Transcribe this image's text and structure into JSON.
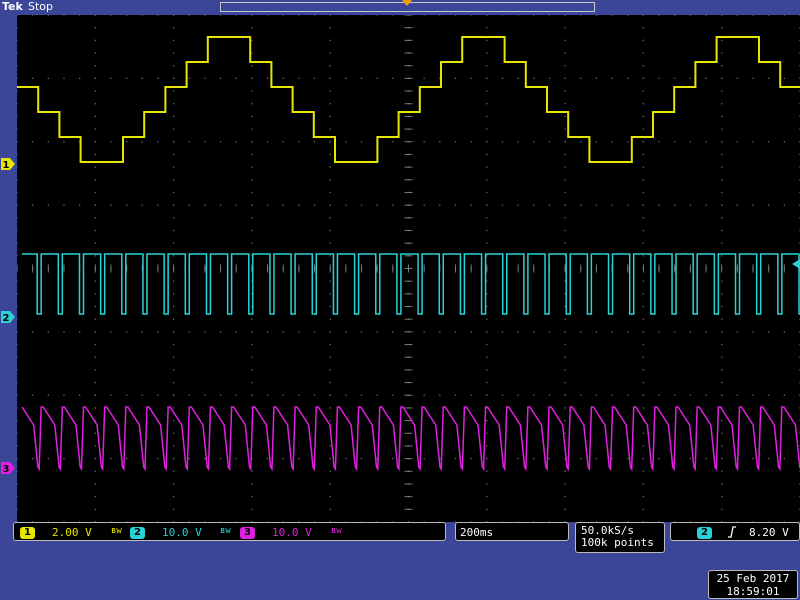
{
  "header": {
    "brand": "Tek",
    "state": "Stop"
  },
  "channels": [
    {
      "id": "1",
      "scale": "2.00 V",
      "color": "#e6e600",
      "marker": "1"
    },
    {
      "id": "2",
      "scale": "10.0 V",
      "color": "#28d2d6",
      "marker": "2"
    },
    {
      "id": "3",
      "scale": "10.0 V",
      "color": "#e020e0",
      "marker": "3"
    }
  ],
  "coupling_icon": "bandwidth-limit-icon",
  "timebase": "200ms",
  "acquisition": {
    "sample_rate": "50.0kS/s",
    "record_length": "100k points"
  },
  "trigger": {
    "source": "2",
    "slope_icon": "rising-edge-icon",
    "level": "8.20 V"
  },
  "date": "25 Feb  2017",
  "time": "18:59:01"
}
